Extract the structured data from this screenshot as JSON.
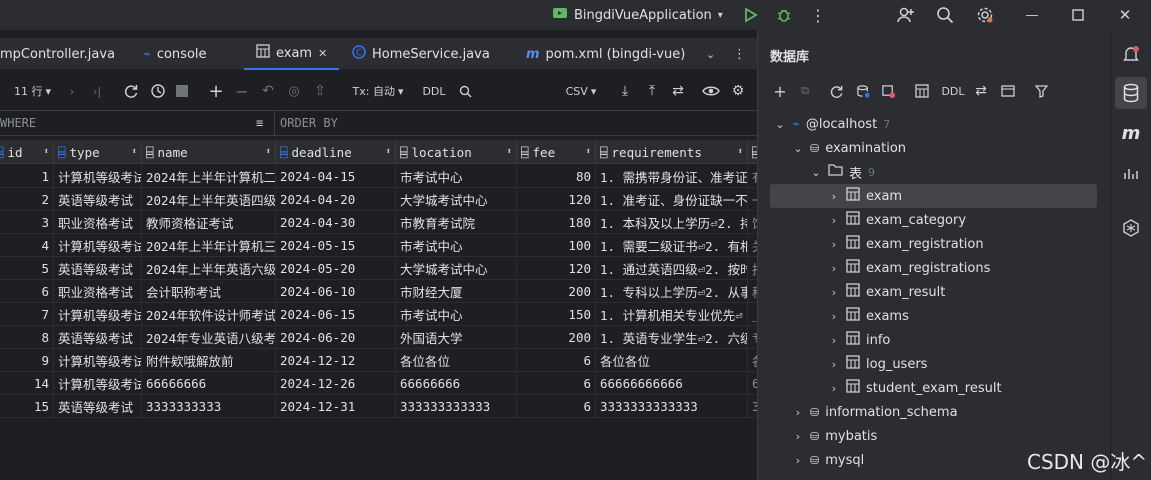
{
  "titlebar": {
    "run_config": "BingdiVueApplication",
    "colors": {
      "run": "#5fb865",
      "debug": "#5fb865"
    }
  },
  "tabs": [
    {
      "label": "mpController.java",
      "icon": "none"
    },
    {
      "label": "console",
      "icon": "console-icon"
    },
    {
      "label": "exam",
      "icon": "table-icon",
      "active": true
    },
    {
      "label": "HomeService.java",
      "icon": "class-icon"
    },
    {
      "label": "pom.xml (bingdi-vue)",
      "icon": "maven-icon"
    }
  ],
  "toolbar": {
    "rows_label": "11 行",
    "tx_label": "Tx: 自动",
    "ddl_label": "DDL",
    "export_label": "CSV"
  },
  "filter": {
    "where": "WHERE",
    "order_by": "ORDER BY"
  },
  "table": {
    "columns": [
      "id",
      "type",
      "name",
      "deadline",
      "location",
      "fee",
      "requirements"
    ],
    "rows": [
      {
        "rn": "1",
        "id": "1",
        "type": "计算机等级考试",
        "name": "2024年上半年计算机二",
        "deadline": "2024-04-15",
        "location": "市考试中心",
        "fee": "80",
        "requirements": "1. 需携带身份证、准考证"
      },
      {
        "rn": "2",
        "id": "2",
        "type": "英语等级考试",
        "name": "2024年上半年英语四级",
        "deadline": "2024-04-20",
        "location": "大学城考试中心",
        "fee": "120",
        "requirements": "1. 准考证、身份证缺一不"
      },
      {
        "rn": "3",
        "id": "3",
        "type": "职业资格考试",
        "name": "教师资格证考试",
        "deadline": "2024-04-30",
        "location": "市教育考试院",
        "fee": "180",
        "requirements": "1. 本科及以上学历⏎2. 持"
      },
      {
        "rn": "4",
        "id": "4",
        "type": "计算机等级考试",
        "name": "2024年上半年计算机三",
        "deadline": "2024-05-15",
        "location": "市考试中心",
        "fee": "100",
        "requirements": "1. 需要二级证书⏎2. 有相"
      },
      {
        "rn": "5",
        "id": "5",
        "type": "英语等级考试",
        "name": "2024年上半年英语六级",
        "deadline": "2024-05-20",
        "location": "大学城考试中心",
        "fee": "120",
        "requirements": "1. 通过英语四级⏎2. 按时"
      },
      {
        "rn": "6",
        "id": "6",
        "type": "职业资格考试",
        "name": "会计职称考试",
        "deadline": "2024-06-10",
        "location": "市财经大厦",
        "fee": "200",
        "requirements": "1. 专科以上学历⏎2. 从事"
      },
      {
        "rn": "7",
        "id": "7",
        "type": "计算机等级考试",
        "name": "2024年软件设计师考试",
        "deadline": "2024-06-15",
        "location": "市考试中心",
        "fee": "150",
        "requirements": "1. 计算机相关专业优先⏎"
      },
      {
        "rn": "8",
        "id": "8",
        "type": "英语等级考试",
        "name": "2024年专业英语八级考",
        "deadline": "2024-06-20",
        "location": "外国语大学",
        "fee": "200",
        "requirements": "1. 英语专业学生⏎2. 六级"
      },
      {
        "rn": "9",
        "id": "9",
        "type": "计算机等级考试",
        "name": "附件欸哦解放前",
        "deadline": "2024-12-12",
        "location": "各位各位",
        "fee": "6",
        "requirements": "各位各位"
      },
      {
        "rn": "10",
        "id": "14",
        "type": "计算机等级考试",
        "name": "66666666",
        "deadline": "2024-12-26",
        "location": "66666666",
        "fee": "6",
        "requirements": "66666666666"
      },
      {
        "rn": "11",
        "id": "15",
        "type": "英语等级考试",
        "name": "3333333333",
        "deadline": "2024-12-31",
        "location": "333333333333",
        "fee": "6",
        "requirements": "3333333333333"
      }
    ],
    "extra_col_chars": [
      "有",
      "一",
      "饱",
      "关",
      "报",
      "种",
      "_",
      "专",
      "各",
      "6",
      "3"
    ]
  },
  "db_panel": {
    "title": "数据库",
    "ddl_label": "DDL",
    "host": "@localhost",
    "host_count": "7",
    "schema": "examination",
    "tables_folder": "表",
    "tables_count": "9",
    "tables": [
      "exam",
      "exam_category",
      "exam_registration",
      "exam_registrations",
      "exam_result",
      "exams",
      "info",
      "log_users",
      "student_exam_result"
    ],
    "other_schemas": [
      "information_schema",
      "mybatis",
      "mysql"
    ]
  },
  "watermark": "CSDN @冰^"
}
